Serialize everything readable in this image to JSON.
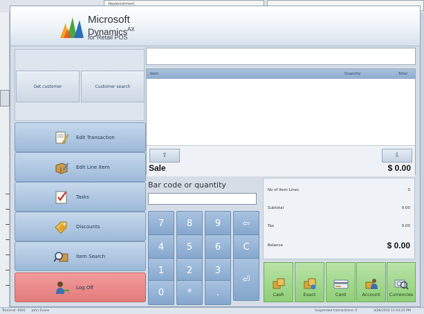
{
  "background": {
    "window_text": "Replenishment"
  },
  "header": {
    "logo_line1": "Microsoft",
    "logo_line2": "Dynamics",
    "logo_ax": "AX",
    "logo_line3": "for Retail POS"
  },
  "customer": {
    "get_customer": "Get customer",
    "customer_search": "Customer search"
  },
  "menu": {
    "edit_transaction": "Edit Transaction",
    "edit_line_item": "Edit Line Item",
    "tasks": "Tasks",
    "discounts": "Discounts",
    "item_search": "Item Search",
    "log_off": "Log Off"
  },
  "receipt": {
    "col_item": "Item",
    "col_quantity": "Quantity",
    "col_total": "Total",
    "up_arrow": "⇧",
    "down_arrow": "⇩",
    "sale_label": "Sale",
    "sale_total": "$ 0.00"
  },
  "keypad": {
    "label": "Bar code or quantity",
    "k7": "7",
    "k8": "8",
    "k9": "9",
    "kback": "⇦",
    "k4": "4",
    "k5": "5",
    "k6": "6",
    "kclear": "C",
    "k1": "1",
    "k2": "2",
    "k3": "3",
    "kenter": "⏎",
    "k0": "0",
    "kstar": "*",
    "kdot": "."
  },
  "totals": {
    "lines_label": "No of Item Lines",
    "lines_value": "0",
    "subtotal_label": "Subtotal",
    "subtotal_value": "0.00",
    "tax_label": "Tax",
    "tax_value": "0.00",
    "balance_label": "Balance",
    "balance_value": "$ 0.00"
  },
  "payment": {
    "cash": "Cash",
    "exact": "Exact",
    "card": "Card",
    "account": "Account",
    "currencies": "Currencies"
  },
  "status": {
    "terminal": "Terminal: 0001",
    "user": "John Evans",
    "suspended": "Suspended transactions: 0",
    "datetime": "3/28/2010 11:03:25 PM"
  }
}
